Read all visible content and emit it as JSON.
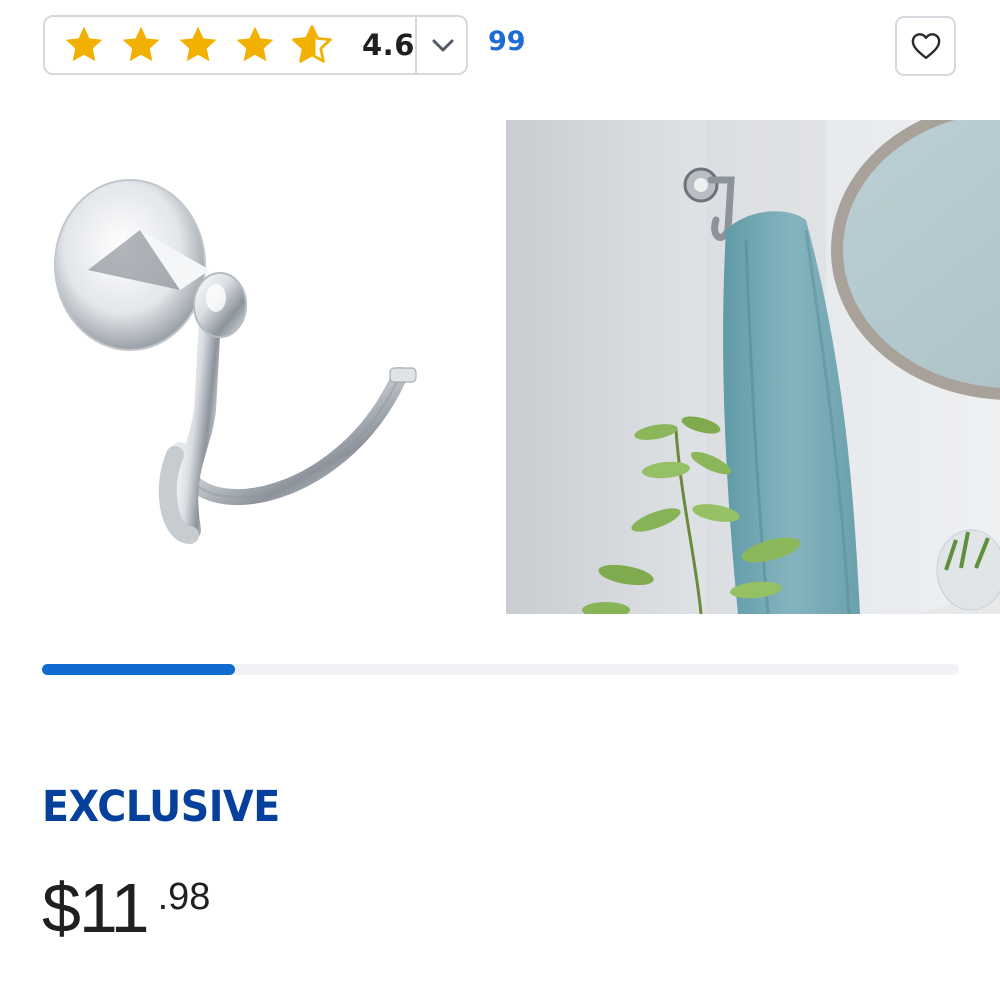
{
  "rating": {
    "value": "4.6",
    "stars_filled": 4.6,
    "star_color": "#f2b000",
    "review_count": "99"
  },
  "icons": {
    "rating_dropdown": "chevron-down-icon",
    "favorite": "heart-icon"
  },
  "gallery": {
    "progress_fraction": 0.21,
    "accent_color": "#0f6bcf"
  },
  "product": {
    "badge": "EXCLUSIVE",
    "badge_color": "#06409d",
    "price_dollars": "$11",
    "price_cents": ".98"
  }
}
